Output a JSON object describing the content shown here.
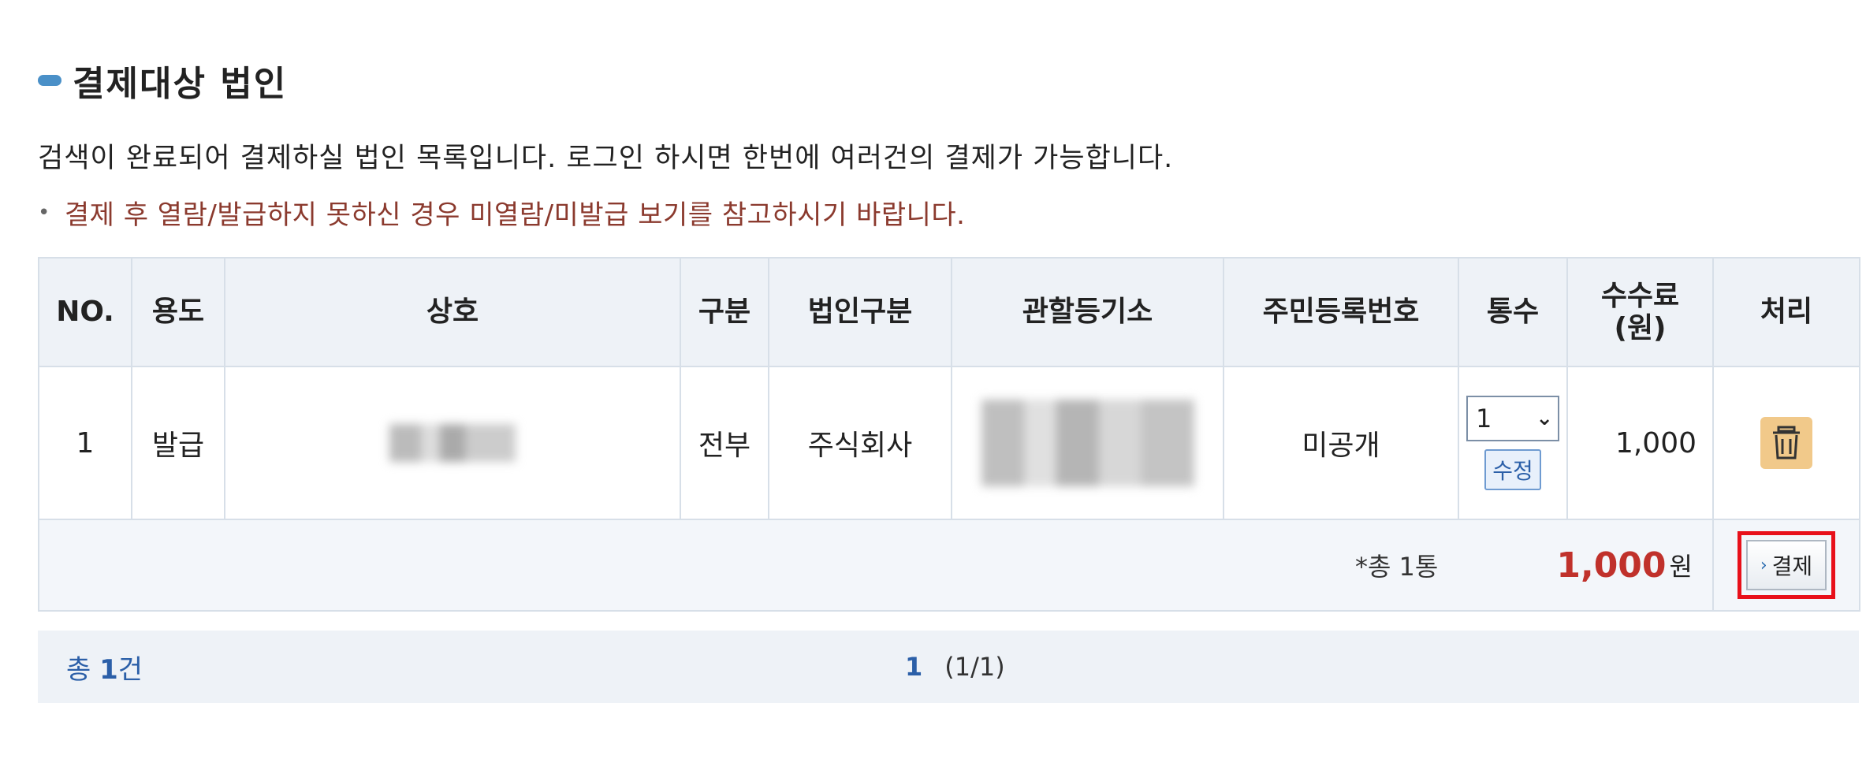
{
  "section": {
    "title": "결제대상 법인"
  },
  "description": "검색이 완료되어 결제하실 법인 목록입니다. 로그인 하시면 한번에 여러건의 결제가 가능합니다.",
  "notice": "결제 후 열람/발급하지 못하신 경우 미열람/미발급 보기를 참고하시기 바랍니다.",
  "table": {
    "headers": {
      "no": "NO.",
      "usage": "용도",
      "company": "상호",
      "type": "구분",
      "corp_type": "법인구분",
      "registry": "관할등기소",
      "resident_no": "주민등록번호",
      "copies": "통수",
      "fee": "수수료\n(원)",
      "action": "처리"
    },
    "rows": [
      {
        "no": "1",
        "usage": "발급",
        "type": "전부",
        "corp_type": "주식회사",
        "resident_no": "미공개",
        "copies": "1",
        "edit_label": "수정",
        "fee": "1,000"
      }
    ],
    "summary": {
      "count": "*총 1통",
      "total": "1,000",
      "unit": "원",
      "pay_label": "결제"
    }
  },
  "footer": {
    "total_prefix": "총",
    "total_count": "1",
    "total_suffix": "건",
    "page": "1",
    "page_info": "(1/1)"
  },
  "colors": {
    "header_bg": "#eef2f7",
    "accent_red": "#c0312b",
    "highlight_border": "#e8101a",
    "link_blue": "#2b5fa8"
  }
}
